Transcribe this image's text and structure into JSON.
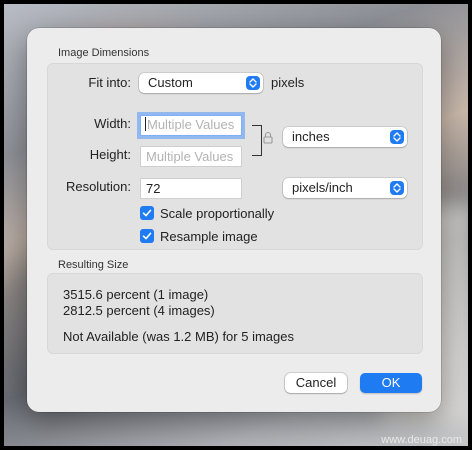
{
  "dialog": {
    "dimensions_title": "Image Dimensions",
    "fit_into": {
      "label": "Fit into:",
      "value": "Custom",
      "unit": "pixels"
    },
    "width": {
      "label": "Width:",
      "placeholder": "Multiple Values"
    },
    "height": {
      "label": "Height:",
      "placeholder": "Multiple Values"
    },
    "size_unit": "inches",
    "resolution": {
      "label": "Resolution:",
      "value": "72",
      "unit": "pixels/inch"
    },
    "scale_proportionally": {
      "label": "Scale proportionally",
      "checked": true
    },
    "resample_image": {
      "label": "Resample image",
      "checked": true
    },
    "resulting_title": "Resulting Size",
    "results": [
      "3515.6 percent (1 image)",
      "2812.5 percent (4 images)",
      "Not Available (was 1.2 MB) for 5 images"
    ],
    "cancel_label": "Cancel",
    "ok_label": "OK"
  },
  "watermark": "www.deuag.com",
  "colors": {
    "accent": "#1f7bf2"
  }
}
